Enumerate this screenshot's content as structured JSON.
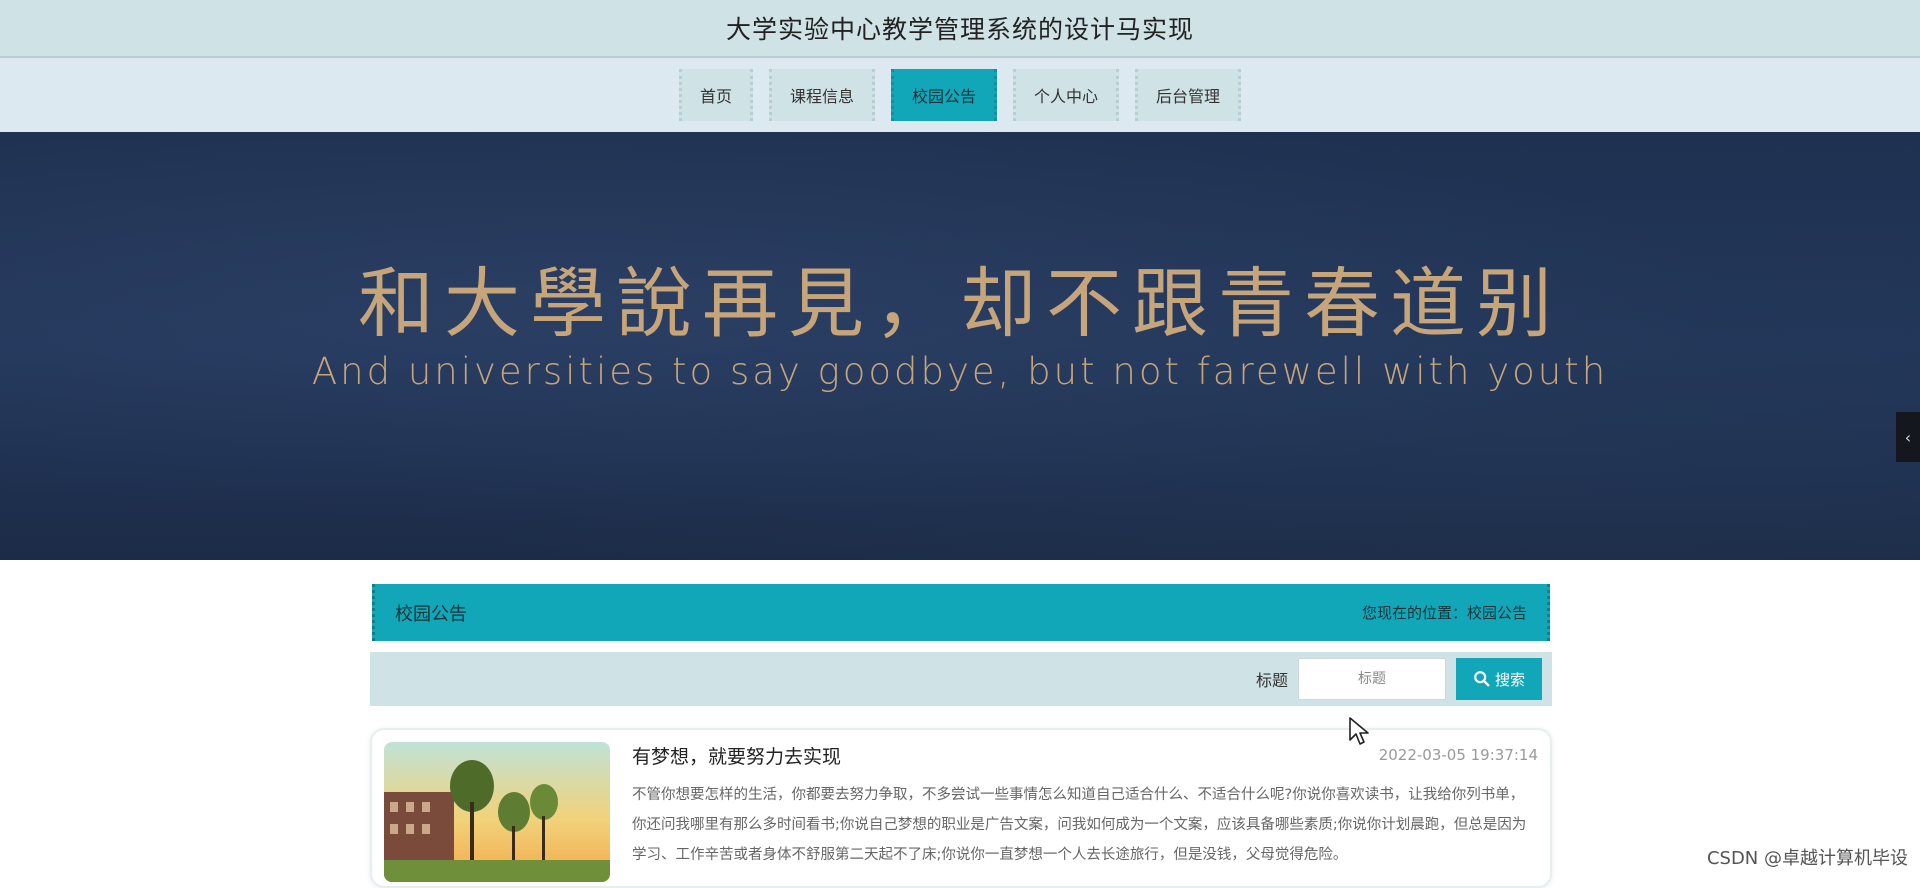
{
  "header": {
    "title": "大学实验中心教学管理系统的设计马实现"
  },
  "nav": {
    "items": [
      {
        "label": "首页",
        "active": false
      },
      {
        "label": "课程信息",
        "active": false
      },
      {
        "label": "校园公告",
        "active": true
      },
      {
        "label": "个人中心",
        "active": false
      },
      {
        "label": "后台管理",
        "active": false
      }
    ]
  },
  "banner": {
    "headline_zh": "和大學說再見，却不跟青春道别",
    "headline_en": "And universities to say goodbye, but not farewell with youth",
    "toggle_icon": "chevron-left-icon"
  },
  "section": {
    "title": "校园公告",
    "breadcrumb": "您现在的位置：校园公告"
  },
  "search": {
    "label": "标题",
    "placeholder": "标题",
    "value": "",
    "button_label": "搜索",
    "icon": "search-icon"
  },
  "notices": [
    {
      "title": "有梦想，就要努力去实现",
      "time": "2022-03-05 19:37:14",
      "summary": "不管你想要怎样的生活，你都要去努力争取，不多尝试一些事情怎么知道自己适合什么、不适合什么呢?你说你喜欢读书，让我给你列书单，你还问我哪里有那么多时间看书;你说自己梦想的职业是广告文案，问我如何成为一个文案，应该具备哪些素质;你说你计划晨跑，但总是因为学习、工作辛苦或者身体不舒服第二天起不了床;你说你一直梦想一个人去长途旅行，但是没钱，父母觉得危险。"
    }
  ],
  "watermark": "CSDN @卓越计算机毕设",
  "colors": {
    "accent": "#12a7b8",
    "header_bg": "#cfe3e6",
    "nav_bg": "#dde9f0",
    "banner_bg": "#22365a",
    "banner_text": "#c7a57a"
  }
}
